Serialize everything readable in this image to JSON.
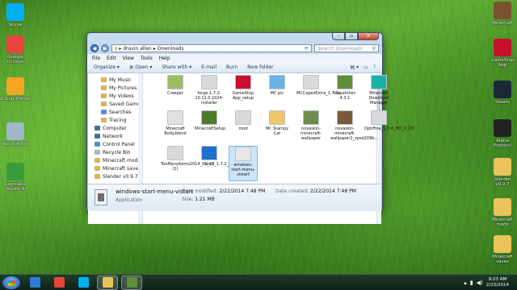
{
  "desktop": {
    "left_icons": [
      {
        "label": "Skype",
        "icon": "skype-icon",
        "color": "#00aff0"
      },
      {
        "label": "Google Chrome",
        "icon": "chrome-icon",
        "color": "#e8453c"
      },
      {
        "label": "iCloud Photos",
        "icon": "icloud-photos-icon",
        "color": "#f5a623"
      },
      {
        "label": "Recycle Bin",
        "icon": "recycle-bin-icon",
        "color": "#9fb7c9"
      },
      {
        "label": "Camtasia Studio 8",
        "icon": "camtasia-icon",
        "color": "#3a9b3a"
      }
    ],
    "right_icons": [
      {
        "label": "Minecraft",
        "icon": "minecraft-icon",
        "color": "#7a5230"
      },
      {
        "label": "GameStop App",
        "icon": "gamestop-icon",
        "color": "#c8102e"
      },
      {
        "label": "Steam",
        "icon": "steam-icon",
        "color": "#1b2838"
      },
      {
        "label": "Alpha Protocol",
        "icon": "alpha-protocol-icon",
        "color": "#222222"
      },
      {
        "label": "Slender v0.9.7",
        "icon": "folder-icon",
        "color": "#e9c45a"
      },
      {
        "label": "Minecraft mods",
        "icon": "folder-icon",
        "color": "#e9c45a"
      },
      {
        "label": "Minecraft saves",
        "icon": "folder-icon",
        "color": "#e9c45a"
      }
    ]
  },
  "window": {
    "address_parts": [
      "dravin allen",
      "Downloads"
    ],
    "search_placeholder": "Search Downloads",
    "menu": [
      "File",
      "Edit",
      "View",
      "Tools",
      "Help"
    ],
    "toolbar": [
      "Organize",
      "Open",
      "Share with",
      "E-mail",
      "Burn",
      "New folder"
    ],
    "nav": [
      {
        "label": "My Music",
        "level": 2,
        "color": "#d8b357"
      },
      {
        "label": "My Pictures",
        "level": 2,
        "color": "#d8b357"
      },
      {
        "label": "My Videos",
        "level": 2,
        "color": "#d8b357"
      },
      {
        "label": "Saved Games",
        "level": 2,
        "color": "#d8b357"
      },
      {
        "label": "Searches",
        "level": 2,
        "color": "#5b8fd8"
      },
      {
        "label": "Tracing",
        "level": 2,
        "color": "#d8b357"
      },
      {
        "label": "Computer",
        "level": 1,
        "color": "#4b6b8f"
      },
      {
        "label": "Network",
        "level": 1,
        "color": "#4b6b8f"
      },
      {
        "label": "Control Panel",
        "level": 1,
        "color": "#4b8fd0"
      },
      {
        "label": "Recycle Bin",
        "level": 1,
        "color": "#9fb7c9"
      },
      {
        "label": "Minecraft mods",
        "level": 1,
        "color": "#d8b357"
      },
      {
        "label": "Minecraft saves",
        "level": 1,
        "color": "#d8b357"
      },
      {
        "label": "Slender v0.9.7",
        "level": 1,
        "color": "#d8b357"
      }
    ],
    "files": [
      {
        "label": "Creeper",
        "color": "#9bbd63"
      },
      {
        "label": "forge-1.7.2-10.12.0.1024-installer",
        "color": "#d9d9d9"
      },
      {
        "label": "GameStop App_setup",
        "color": "#c8102e"
      },
      {
        "label": "MC pic",
        "color": "#6bb2e6"
      },
      {
        "label": "MCCapesExtra_1.7.2a",
        "color": "#d9d9d9"
      },
      {
        "label": "mcpatcher-4.3.1",
        "color": "#5f8f3a"
      },
      {
        "label": "Minecraft Download Manager",
        "color": "#1ab2a6"
      },
      {
        "label": "Minecraft Body.blend",
        "color": "#e0e0e0"
      },
      {
        "label": "MinecraftSetup",
        "color": "#4e7a2a"
      },
      {
        "label": "mod",
        "color": "#d9d9d9"
      },
      {
        "label": "Mr. Stampy Cat",
        "color": "#f0c66b"
      },
      {
        "label": "novaskin-minecraft-wallpaper",
        "color": "#6d8c4a"
      },
      {
        "label": "novaskin-minecraft-wallpaper1_zpsd209b...",
        "color": "#7a5a3a"
      },
      {
        "label": "OptiFine_1.7.4_HD_U_C8",
        "color": "#d9d9d9"
      },
      {
        "label": "TooManyItems2014_01_13_1.7.2_Forge (1)",
        "color": "#d9d9d9"
      },
      {
        "label": "win8",
        "color": "#1f6fd1"
      },
      {
        "label": "windows-start-menu-vistart",
        "color": "#e6e6e6",
        "selected": true
      }
    ],
    "details": {
      "name": "windows-start-menu-vistart",
      "type": "Application",
      "modified_label": "Date modified:",
      "modified_value": "2/22/2014 7:48 PM",
      "size_label": "Size:",
      "size_value": "1.21 MB",
      "created_label": "Date created:",
      "created_value": "2/22/2014 7:48 PM"
    }
  },
  "taskbar": {
    "items": [
      {
        "name": "ie",
        "color": "#2a7fd4"
      },
      {
        "name": "chrome",
        "color": "#e8453c"
      },
      {
        "name": "skype",
        "color": "#00aff0"
      },
      {
        "name": "explorer",
        "color": "#e9c45a"
      },
      {
        "name": "minecraft",
        "color": "#5f8f3a"
      }
    ],
    "time": "9:23 AM",
    "date": "2/23/2014"
  }
}
